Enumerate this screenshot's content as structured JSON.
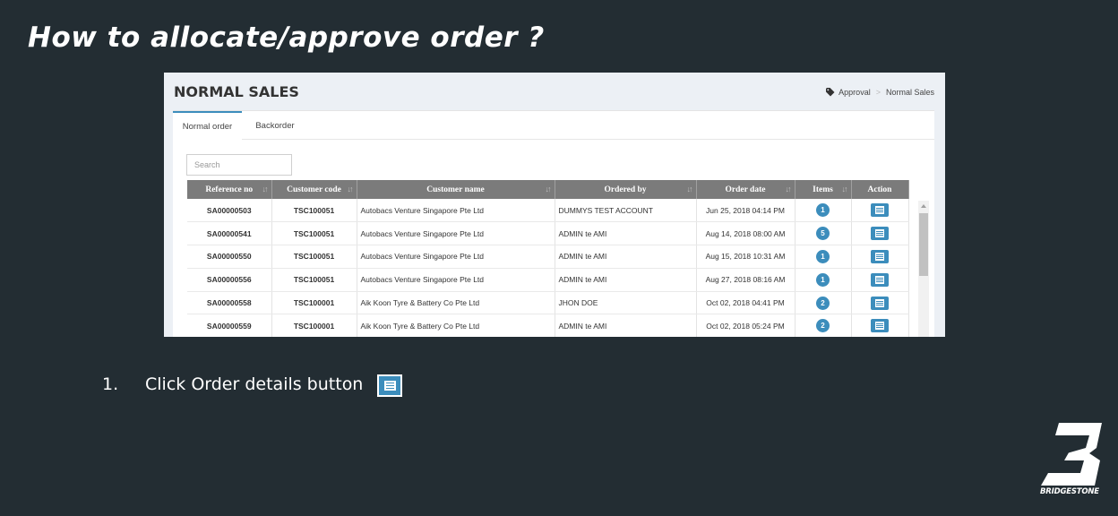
{
  "slide": {
    "title": "How to allocate/approve order ?",
    "step_number": "1.",
    "step_text": "Click Order details button"
  },
  "app": {
    "page_title": "NORMAL SALES",
    "breadcrumb": [
      "Approval",
      "Normal Sales"
    ],
    "tabs": [
      {
        "label": "Normal order",
        "active": true
      },
      {
        "label": "Backorder",
        "active": false
      }
    ],
    "search_placeholder": "Search",
    "table": {
      "columns": [
        "Reference no",
        "Customer code",
        "Customer name",
        "Ordered by",
        "Order date",
        "Items",
        "Action"
      ],
      "rows": [
        {
          "ref": "SA00000503",
          "code": "TSC100051",
          "name": "Autobacs Venture Singapore Pte Ltd",
          "by": "DUMMYS TEST ACCOUNT",
          "date": "Jun 25, 2018 04:14 PM",
          "items": "1"
        },
        {
          "ref": "SA00000541",
          "code": "TSC100051",
          "name": "Autobacs Venture Singapore Pte Ltd",
          "by": "ADMIN te AMI",
          "date": "Aug 14, 2018 08:00 AM",
          "items": "5"
        },
        {
          "ref": "SA00000550",
          "code": "TSC100051",
          "name": "Autobacs Venture Singapore Pte Ltd",
          "by": "ADMIN te AMI",
          "date": "Aug 15, 2018 10:31 AM",
          "items": "1"
        },
        {
          "ref": "SA00000556",
          "code": "TSC100051",
          "name": "Autobacs Venture Singapore Pte Ltd",
          "by": "ADMIN te AMI",
          "date": "Aug 27, 2018 08:16 AM",
          "items": "1"
        },
        {
          "ref": "SA00000558",
          "code": "TSC100001",
          "name": "Aik Koon Tyre & Battery Co Pte Ltd",
          "by": "JHON DOE",
          "date": "Oct 02, 2018 04:41 PM",
          "items": "2"
        },
        {
          "ref": "SA00000559",
          "code": "TSC100001",
          "name": "Aik Koon Tyre & Battery Co Pte Ltd",
          "by": "ADMIN te AMI",
          "date": "Oct 02, 2018 05:24 PM",
          "items": "2"
        }
      ]
    }
  },
  "brand": {
    "logo_text": "BRIDGESTONE",
    "accent": "#3c8dbc",
    "background": "#232d33"
  }
}
